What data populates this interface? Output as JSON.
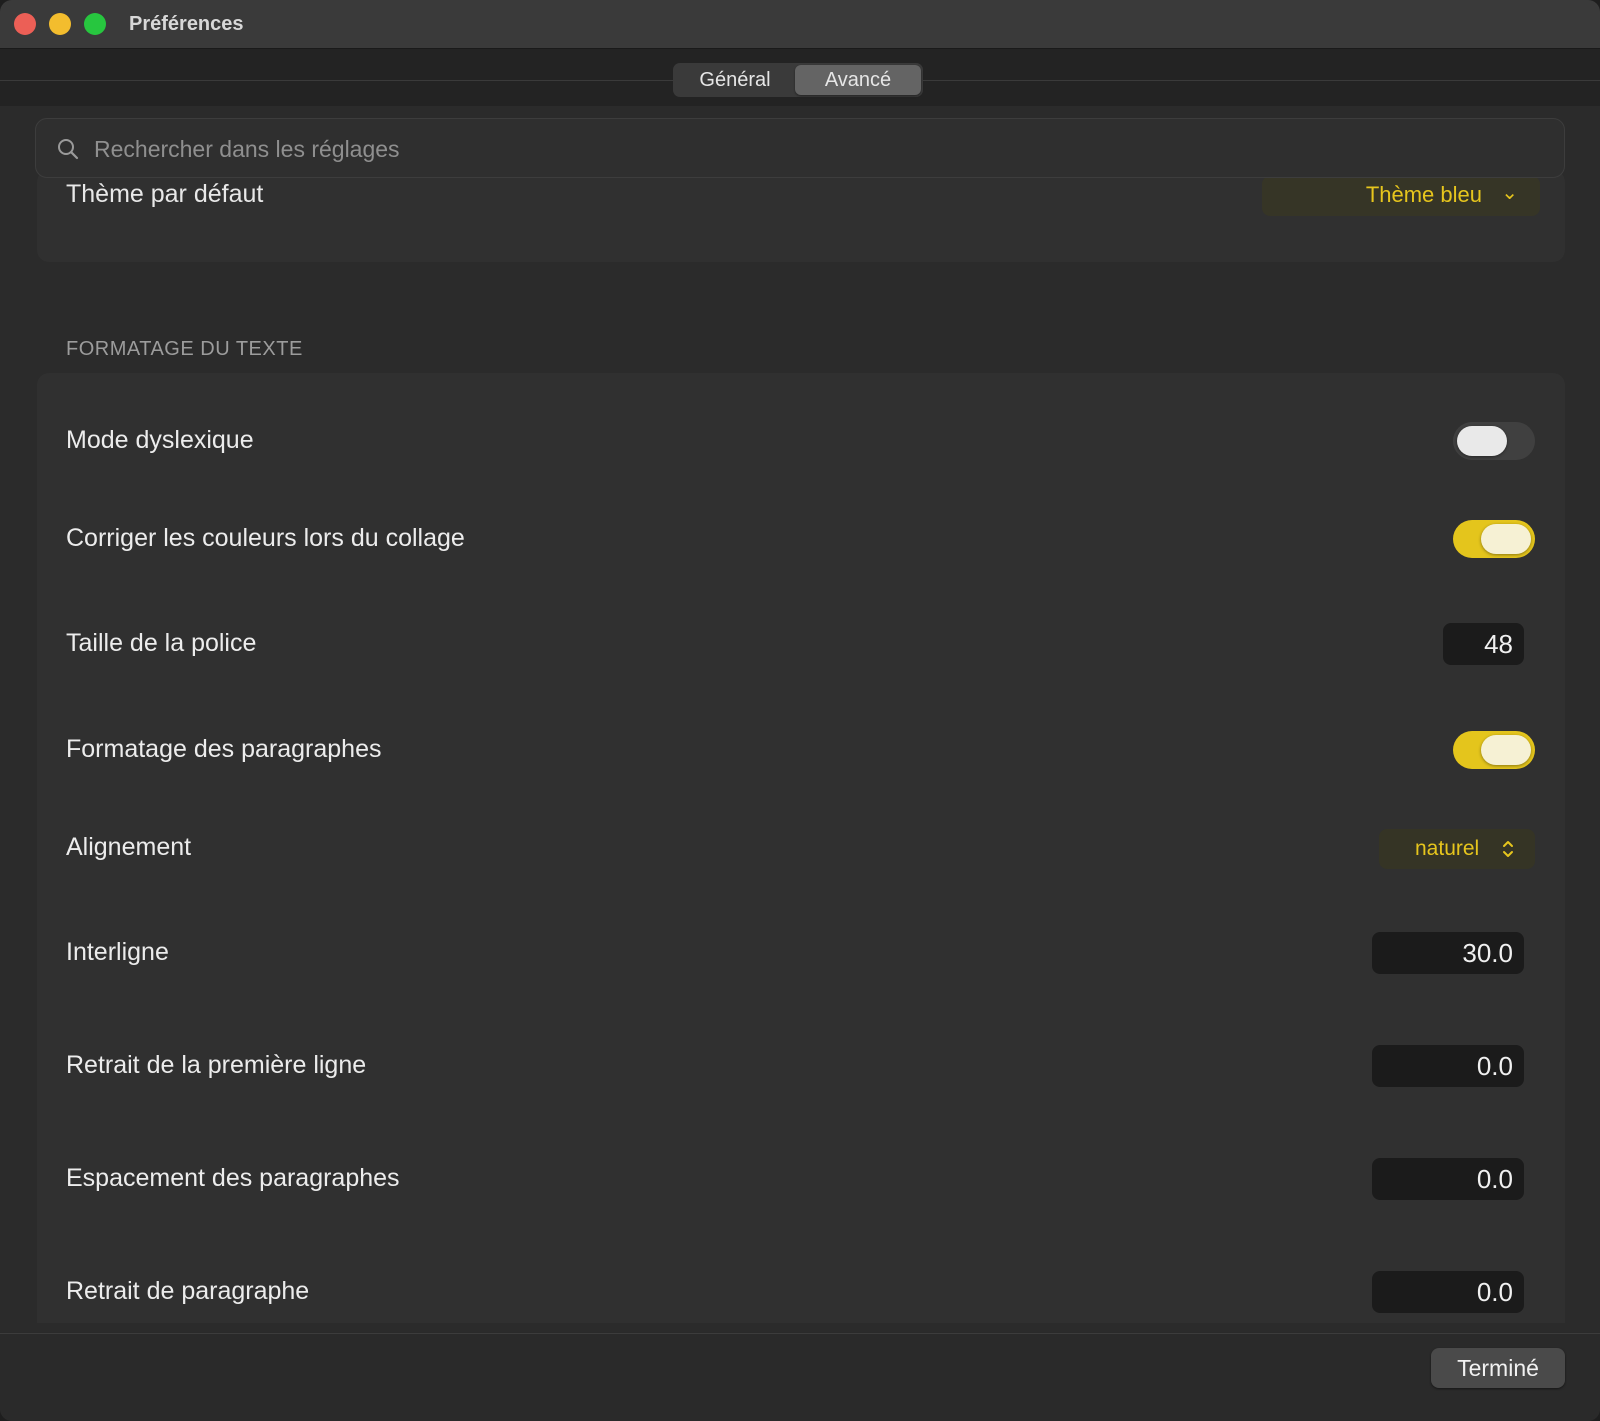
{
  "window": {
    "title": "Préférences"
  },
  "tabs": [
    {
      "label": "Général",
      "selected": false
    },
    {
      "label": "Avancé",
      "selected": true
    }
  ],
  "search": {
    "placeholder": "Rechercher dans les réglages",
    "value": ""
  },
  "cut_row": {
    "label": "Thème par défaut",
    "value": "Thème bleu",
    "icon": "chevron-down-icon"
  },
  "section": {
    "title": "FORMATAGE DU TEXTE",
    "rows": [
      {
        "label": "Mode dyslexique",
        "type": "toggle",
        "on": false
      },
      {
        "label": "Corriger les couleurs lors du collage",
        "type": "toggle",
        "on": true
      },
      {
        "label": "Taille de la police",
        "type": "number",
        "value": "48"
      },
      {
        "label": "Formatage des paragraphes",
        "type": "toggle",
        "on": true
      },
      {
        "label": "Alignement",
        "type": "popup",
        "value": "naturel",
        "icon": "up-down-chevron-icon"
      },
      {
        "label": "Interligne",
        "type": "number",
        "value": "30.0"
      },
      {
        "label": "Retrait de la première ligne",
        "type": "number",
        "value": "0.0"
      },
      {
        "label": "Espacement des paragraphes",
        "type": "number",
        "value": "0.0"
      },
      {
        "label": "Retrait de paragraphe",
        "type": "number",
        "value": "0.0"
      }
    ]
  },
  "footer": {
    "done_label": "Terminé"
  },
  "colors": {
    "accent": "#e4c51c",
    "background": "#2a2a2a",
    "card": "#303030",
    "close": "#ec5f56",
    "minimize": "#f3bd2e",
    "maximize": "#27c63f"
  }
}
